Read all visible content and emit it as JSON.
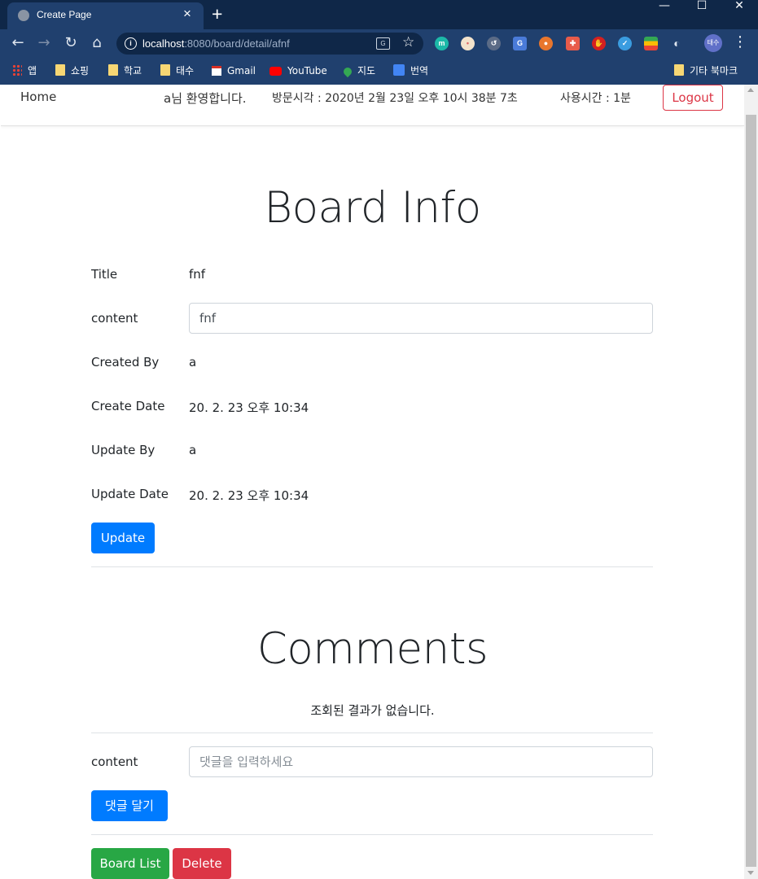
{
  "browser": {
    "tab_title": "Create Page",
    "tab_close": "×",
    "new_tab": "+",
    "window_controls": {
      "minimize": "—",
      "maximize": "☐",
      "close": "✕"
    },
    "url_host": "localhost",
    "url_rest": ":8080/board/detail/afnf",
    "profile_initials": "태수",
    "bookmarks": [
      {
        "label": "앱",
        "icon": "apps-grid-icon"
      },
      {
        "label": "쇼핑",
        "icon": "folder-icon"
      },
      {
        "label": "학교",
        "icon": "folder-icon"
      },
      {
        "label": "태수",
        "icon": "folder-icon"
      },
      {
        "label": "Gmail",
        "icon": "gmail-icon"
      },
      {
        "label": "YouTube",
        "icon": "youtube-icon"
      },
      {
        "label": "지도",
        "icon": "maps-icon"
      },
      {
        "label": "번역",
        "icon": "translate-icon"
      }
    ],
    "other_bookmarks": "기타 북마크"
  },
  "nav": {
    "home": "Home",
    "welcome": "a님 환영합니다.",
    "visit_time": "방문시각 : 2020년 2월 23일 오후 10시 38분 7초",
    "usage_time": "사용시간 : 1분",
    "logout": "Logout"
  },
  "board": {
    "heading": "Board Info",
    "title_label": "Title",
    "title_value": "fnf",
    "content_label": "content",
    "content_value": "fnf",
    "created_by_label": "Created By",
    "created_by_value": "a",
    "create_date_label": "Create Date",
    "create_date_value": "20. 2. 23 오후 10:34",
    "update_by_label": "Update By",
    "update_by_value": "a",
    "update_date_label": "Update Date",
    "update_date_value": "20. 2. 23 오후 10:34",
    "update_button": "Update"
  },
  "comments": {
    "heading": "Comments",
    "empty_message": "조회된 결과가 없습니다.",
    "content_label": "content",
    "input_placeholder": "댓글을 입력하세요",
    "submit_button": "댓글 달기",
    "board_list_button": "Board List",
    "delete_button": "Delete"
  },
  "colors": {
    "primary": "#007bff",
    "success": "#28a745",
    "danger": "#dc3545",
    "chrome_dark": "#0f2748",
    "chrome_toolbar": "#20406e"
  }
}
